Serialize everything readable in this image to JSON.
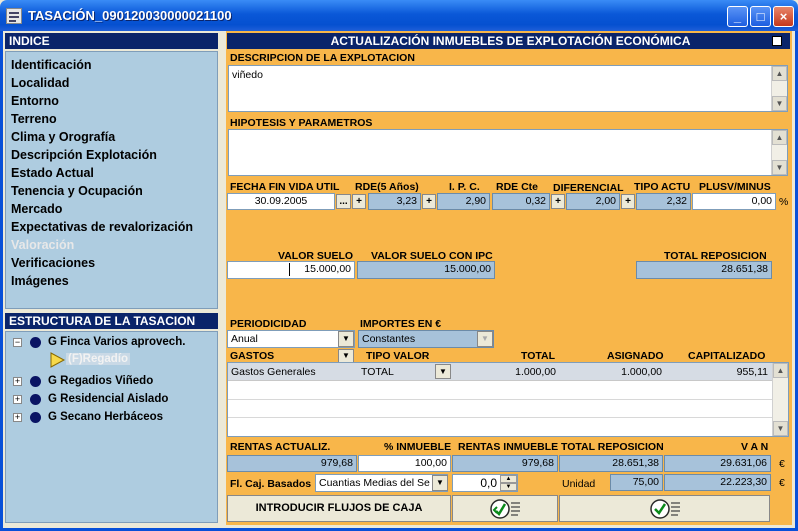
{
  "window": {
    "title": "TASACIÓN_090120030000021100",
    "min": "_",
    "max": "□",
    "close": "×"
  },
  "indice": {
    "header": "INDICE",
    "items": [
      "Identificación",
      "Localidad",
      "Entorno",
      "Terreno",
      "Clima y Orografía",
      "Descripción Explotación",
      "Estado Actual",
      "Tenencia y Ocupación",
      "Mercado",
      "Expectativas de revalorización",
      "Valoración",
      "Verificaciones",
      "Imágenes"
    ],
    "disabled_index": 10
  },
  "estructura": {
    "header": "ESTRUCTURA DE LA TASACION",
    "root": "G Finca Varios aprovech.",
    "child": "(F)Regadío",
    "siblings": [
      "G Regadios Viñedo",
      "G Residencial Aislado",
      "G Secano Herbáceos"
    ]
  },
  "main": {
    "header": "ACTUALIZACIÓN INMUEBLES DE EXPLOTACIÓN ECONÓMICA",
    "descripcion_label": "DESCRIPCION DE LA EXPLOTACION",
    "descripcion_value": "viñedo",
    "hipotesis_label": "HIPOTESIS Y PARAMETROS",
    "hipotesis_value": "",
    "params": {
      "fecha_label": "FECHA FIN VIDA UTIL",
      "fecha_value": "30.09.2005",
      "fecha_btn": "...",
      "rde5_label": "RDE(5 Años)",
      "rde5_value": "3,23",
      "ipc_label": "I. P. C.",
      "ipc_value": "2,90",
      "rdecte_label": "RDE Cte",
      "rdecte_value": "0,32",
      "diferencial_label": "DIFERENCIAL",
      "diferencial_value": "2,00",
      "tipoactu_label": "TIPO ACTU",
      "tipoactu_value": "2,32",
      "plusv_label": "PLUSV/MINUS",
      "plusv_value": "0,00",
      "plusv_unit": "%",
      "plus": "+"
    },
    "valor_suelo_label": "VALOR SUELO",
    "valor_suelo_value": "15.000,00",
    "valor_suelo_ipc_label": "VALOR SUELO CON IPC",
    "valor_suelo_ipc_value": "15.000,00",
    "total_reposicion_label": "TOTAL REPOSICION",
    "total_reposicion_value": "28.651,38",
    "periodicidad_label": "PERIODICIDAD",
    "periodicidad_value": "Anual",
    "importes_label": "IMPORTES EN €",
    "importes_value": "Constantes",
    "gastos_table": {
      "headers": [
        "GASTOS",
        "TIPO VALOR",
        "TOTAL",
        "ASIGNADO",
        "CAPITALIZADO"
      ],
      "rows": [
        [
          "Gastos Generales",
          "TOTAL",
          "1.000,00",
          "1.000,00",
          "955,11"
        ]
      ]
    },
    "rentas": {
      "actualiz_label": "RENTAS ACTUALIZ.",
      "actualiz_value": "979,68",
      "pct_label": "% INMUEBLE",
      "pct_value": "100,00",
      "inmueble_label": "RENTAS INMUEBLE",
      "inmueble_value": "979,68",
      "total_rep_label": "TOTAL REPOSICION",
      "total_rep_value": "28.651,38",
      "van_label": "V A N",
      "van_value": "29.631,06",
      "euro": "€"
    },
    "flcaj_label": "Fl. Caj. Basados",
    "flcaj_value": "Cuantias Medias del Se",
    "stepper_value": "0,0",
    "unidad_label": "Unidad",
    "unidad_value": "75,00",
    "unidad_total": "22.223,30",
    "introducir_label": "INTRODUCIR FLUJOS DE CAJA"
  }
}
